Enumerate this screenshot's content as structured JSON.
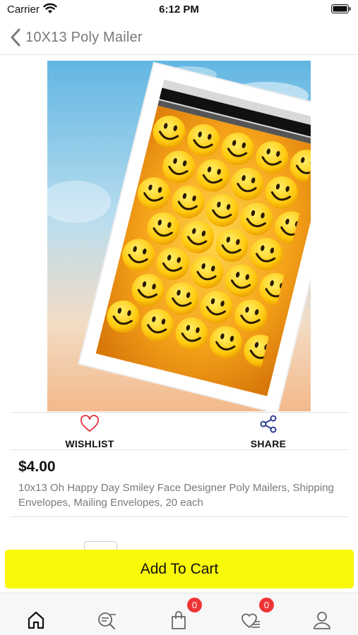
{
  "status_bar": {
    "carrier": "Carrier",
    "time": "6:12 PM"
  },
  "nav": {
    "title": "10X13 Poly Mailer",
    "back_icon": "chevron-left-icon"
  },
  "product": {
    "image_alt": "poly-mailer-smiley-image",
    "price": "$4.00",
    "description": "10x13 Oh Happy Day Smiley Face Designer Poly Mailers, Shipping Envelopes, Mailing Envelopes, 20 each"
  },
  "actions": {
    "wishlist_label": "WISHLIST",
    "share_label": "SHARE"
  },
  "cart_button": {
    "label": "Add To Cart"
  },
  "tab_bar": {
    "items": [
      {
        "name": "home",
        "icon": "home-icon"
      },
      {
        "name": "search",
        "icon": "search-icon"
      },
      {
        "name": "cart",
        "icon": "shopping-bag-icon",
        "badge": "0"
      },
      {
        "name": "wishlist",
        "icon": "heart-list-icon",
        "badge": "0"
      },
      {
        "name": "profile",
        "icon": "user-icon"
      }
    ]
  },
  "colors": {
    "accent_yellow": "#f9f90a",
    "badge_red": "#ee3434",
    "wishlist_heart": "#e0303a",
    "share_blue": "#2c3e8f"
  }
}
